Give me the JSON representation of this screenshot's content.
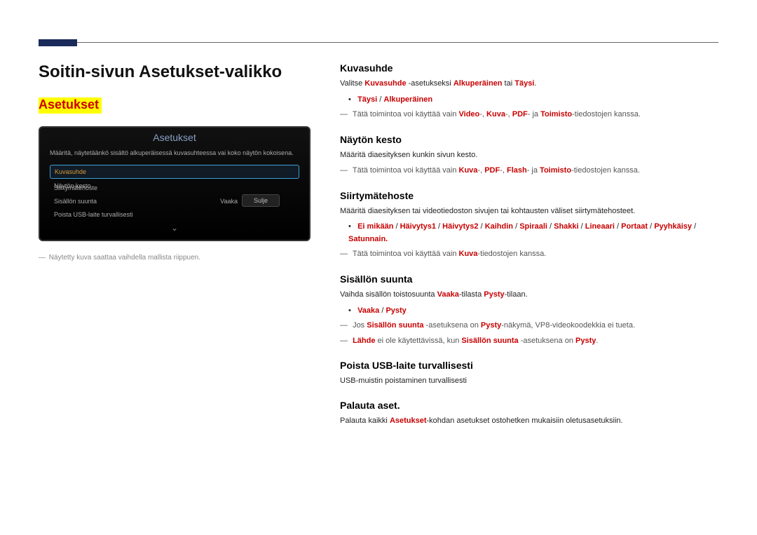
{
  "page_heading": "Soitin-sivun Asetukset-valikko",
  "highlight": "Asetukset",
  "tv": {
    "title": "Asetukset",
    "desc": "Määritä, näytetäänkö sisältö alkuperäisessä kuvasuhteessa vai koko näytön kokoisena.",
    "rows": {
      "r1": "Kuvasuhde",
      "r2": "Näytön kesto",
      "r3": "Siirtymätehoste",
      "r4_label": "Sisällön suunta",
      "r4_value": "Vaaka",
      "r5": "Poista USB-laite turvallisesti"
    },
    "close": "Sulje",
    "chevron": "⌄"
  },
  "left_caption_dash": "―",
  "left_caption": "Näytetty kuva saattaa vaihdella mallista riippuen.",
  "kuvasuhde": {
    "title": "Kuvasuhde",
    "line1_a": "Valitse ",
    "line1_b": "Kuvasuhde",
    "line1_c": " -asetukseksi ",
    "line1_d": "Alkuperäinen",
    "line1_e": " tai ",
    "line1_f": "Täysi",
    "line1_g": ".",
    "bullet_a": "Täysi",
    "bullet_sep": " / ",
    "bullet_b": "Alkuperäinen",
    "note_dash": "―",
    "note_a": "Tätä toimintoa voi käyttää vain ",
    "note_b": "Video",
    "note_c": "-, ",
    "note_d": "Kuva",
    "note_e": "-, ",
    "note_f": "PDF",
    "note_g": "- ja ",
    "note_h": "Toimisto",
    "note_i": "-tiedostojen kanssa."
  },
  "nayton": {
    "title": "Näytön kesto",
    "p": "Määritä diaesityksen kunkin sivun kesto.",
    "note_dash": "―",
    "note_a": "Tätä toimintoa voi käyttää vain ",
    "note_b": "Kuva",
    "note_c": "-, ",
    "note_d": "PDF",
    "note_e": "-, ",
    "note_f": "Flash",
    "note_g": "- ja ",
    "note_h": "Toimisto",
    "note_i": "-tiedostojen kanssa."
  },
  "siirtyma": {
    "title": "Siirtymätehoste",
    "p": "Määritä diaesityksen tai videotiedoston sivujen tai kohtausten väliset siirtymätehosteet.",
    "bullets": {
      "b1": "Ei mikään",
      "b2": "Häivytys1",
      "b3": "Häivytys2",
      "b4": "Kaihdin",
      "b5": "Spiraali",
      "b6": "Shakki",
      "b7": "Lineaari",
      "b8": "Portaat",
      "b9": "Pyyhkäisy",
      "b10": "Satunnain.",
      "sep": " / "
    },
    "note_dash": "―",
    "note_a": "Tätä toimintoa voi käyttää vain ",
    "note_b": "Kuva",
    "note_c": "-tiedostojen kanssa."
  },
  "sisallon": {
    "title": "Sisällön suunta",
    "p_a": "Vaihda sisällön toistosuunta ",
    "p_b": "Vaaka",
    "p_c": "-tilasta ",
    "p_d": "Pysty",
    "p_e": "-tilaan.",
    "bullet_a": "Vaaka",
    "bullet_sep": " / ",
    "bullet_b": "Pysty",
    "note1_dash": "―",
    "note1_a": "Jos ",
    "note1_b": "Sisällön suunta",
    "note1_c": " -asetuksena on ",
    "note1_d": "Pysty",
    "note1_e": "-näkymä, VP8-videokoodekkia ei tueta.",
    "note2_dash": "―",
    "note2_a": "Lähde",
    "note2_b": " ei ole käytettävissä, kun ",
    "note2_c": "Sisällön suunta",
    "note2_d": " -asetuksena on ",
    "note2_e": "Pysty",
    "note2_f": "."
  },
  "poista": {
    "title": "Poista USB-laite turvallisesti",
    "p": "USB-muistin poistaminen turvallisesti"
  },
  "palauta": {
    "title": "Palauta aset.",
    "p_a": "Palauta kaikki ",
    "p_b": "Asetukset",
    "p_c": "-kohdan asetukset ostohetken mukaisiin oletusasetuksiin."
  }
}
